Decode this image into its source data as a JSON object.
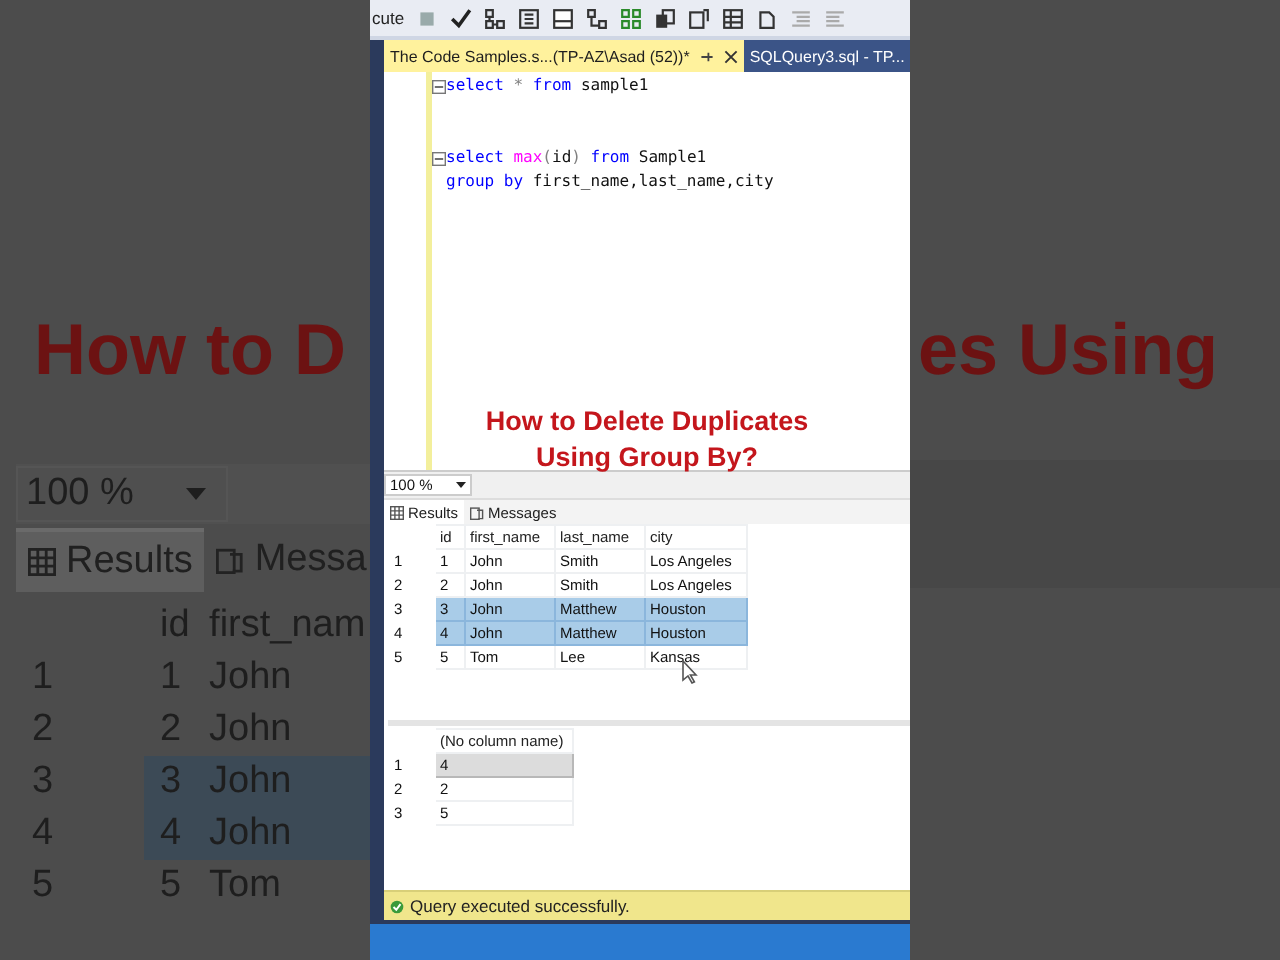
{
  "background": {
    "heading_left": "How to D",
    "heading_right": "es Using",
    "zoom": "100 %",
    "tabs": [
      {
        "label": "Results",
        "selected": true
      },
      {
        "label": "Messa",
        "selected": false
      }
    ],
    "columns": [
      "id",
      "first_nam"
    ],
    "rows": [
      {
        "number": "1",
        "cells": [
          "1",
          "John"
        ],
        "selected": false
      },
      {
        "number": "2",
        "cells": [
          "2",
          "John"
        ],
        "selected": false
      },
      {
        "number": "3",
        "cells": [
          "3",
          "John"
        ],
        "selected": true
      },
      {
        "number": "4",
        "cells": [
          "4",
          "John"
        ],
        "selected": true
      },
      {
        "number": "5",
        "cells": [
          "5",
          "Tom"
        ],
        "selected": false
      }
    ]
  },
  "toolbar": {
    "label": "cute"
  },
  "doc_tabs": [
    {
      "label": "The Code Samples.s...(TP-AZ\\Asad (52))*",
      "selected": true
    },
    {
      "label": "SQLQuery3.sql - TP...",
      "selected": false
    }
  ],
  "editor": {
    "statements": [
      {
        "lines": [
          [
            {
              "text": "select",
              "kind": "keyword"
            },
            {
              "text": " * ",
              "kind": "operator"
            },
            {
              "text": "from",
              "kind": "keyword"
            },
            {
              "text": " sample1",
              "kind": "plain"
            }
          ]
        ]
      },
      {
        "lines": [
          [
            {
              "text": "select",
              "kind": "keyword"
            },
            {
              "text": " max",
              "kind": "function"
            },
            {
              "text": "(",
              "kind": "operator"
            },
            {
              "text": "id",
              "kind": "plain"
            },
            {
              "text": ")",
              "kind": "operator"
            },
            {
              "text": " from",
              "kind": "keyword"
            },
            {
              "text": " Sample1",
              "kind": "plain"
            }
          ],
          [
            {
              "text": "group by",
              "kind": "keyword"
            },
            {
              "text": " first_name,last_name,city",
              "kind": "plain"
            }
          ]
        ]
      }
    ]
  },
  "overlay_title": "How to Delete Duplicates Using Group By?",
  "zoom": "100 %",
  "result_tabs": [
    {
      "label": "Results",
      "selected": true
    },
    {
      "label": "Messages",
      "selected": false
    }
  ],
  "grids": [
    {
      "columns": [
        "id",
        "first_name",
        "last_name",
        "city"
      ],
      "rows": [
        {
          "number": "1",
          "cells": [
            "1",
            "John",
            "Smith",
            "Los Angeles"
          ],
          "selected": false
        },
        {
          "number": "2",
          "cells": [
            "2",
            "John",
            "Smith",
            "Los Angeles"
          ],
          "selected": false
        },
        {
          "number": "3",
          "cells": [
            "3",
            "John",
            "Matthew",
            "Houston"
          ],
          "selected": true
        },
        {
          "number": "4",
          "cells": [
            "4",
            "John",
            "Matthew",
            "Houston"
          ],
          "selected": true
        },
        {
          "number": "5",
          "cells": [
            "5",
            "Tom",
            "Lee",
            "Kansas"
          ],
          "selected": false
        }
      ]
    },
    {
      "columns": [
        "(No column name)"
      ],
      "rows": [
        {
          "number": "1",
          "cells": [
            "4"
          ],
          "selected": true
        },
        {
          "number": "2",
          "cells": [
            "2"
          ],
          "selected": false
        },
        {
          "number": "3",
          "cells": [
            "5"
          ],
          "selected": false
        }
      ]
    }
  ],
  "status": {
    "text": "Query executed successfully."
  }
}
